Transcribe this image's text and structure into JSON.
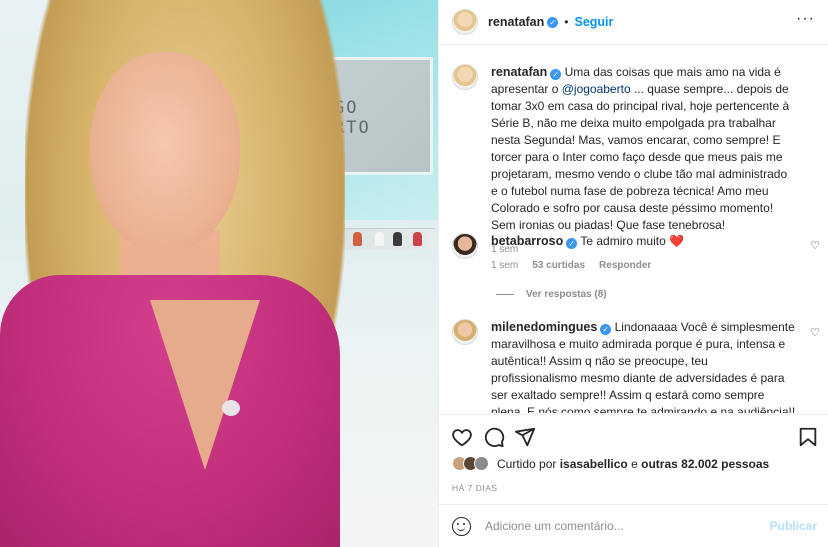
{
  "header": {
    "username": "renatafan",
    "follow_label": "Seguir",
    "separator": "•",
    "more_label": "···"
  },
  "photo": {
    "screen_text_line1": "JOGO",
    "screen_text_line2": "ABERTO"
  },
  "caption": {
    "username": "renatafan",
    "text_before_mention": "Uma das coisas que mais amo na vida é apresentar o ",
    "mention": "@jogoaberto",
    "text_after_mention": " ... quase sempre... depois de tomar 3x0 em casa do principal rival, hoje pertencente à Série B, não me deixa muito empolgada pra trabalhar nesta Segunda! Mas, vamos encarar, como sempre! E torcer para o Inter como faço desde que meus pais me projetaram, mesmo vendo o clube tão mal administrado e o futebol numa fase de pobreza técnica! Amo meu Colorado e sofro por causa deste péssimo momento! Sem ironias ou piadas! Que fase tenebrosa!",
    "time": "1 sem"
  },
  "comments": [
    {
      "username": "betabarroso",
      "text": "Te admiro muito ❤️",
      "time": "1 sem",
      "likes": "53 curtidas",
      "reply_label": "Responder",
      "view_replies": "Ver respostas (8)"
    },
    {
      "username": "milenedomingues",
      "text": "Lindonaaaa Você é simplesmente maravilhosa e muito admirada porque é pura, intensa e autêntica!! Assim q não se preocupe, teu profissionalismo mesmo diante de adversidades é para ser exaltado sempre!! Assim q estará como sempre plena. E nós como sempre te admirando e na audiência!! Beijão no coração"
    }
  ],
  "actions": {
    "like_icon": "heart-icon",
    "comment_icon": "comment-icon",
    "share_icon": "share-icon",
    "save_icon": "bookmark-icon"
  },
  "liked_by": {
    "prefix": "Curtido por ",
    "user": "isasabellico",
    "suffix": " e ",
    "others": "outras 82.002 pessoas"
  },
  "post_time": "HÁ 7 DIAS",
  "add_comment": {
    "placeholder": "Adicione um comentário...",
    "publish_label": "Publicar"
  },
  "colors": {
    "accent": "#0095f6",
    "verified": "#3897f0",
    "publish_disabled": "#b2dffc",
    "heart": "#ed4956"
  }
}
